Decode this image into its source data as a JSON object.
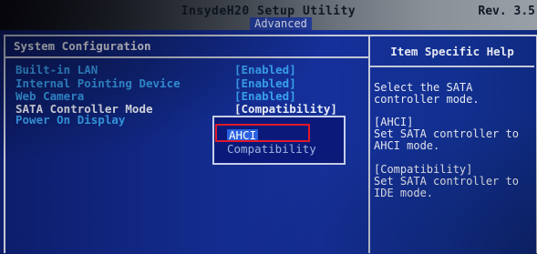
{
  "header": {
    "title": "InsydeH20 Setup Utility",
    "revision": "Rev. 3.5",
    "active_tab": "Advanced"
  },
  "left_panel": {
    "section_title": "System Configuration",
    "items": [
      {
        "label": "Built-in LAN",
        "value": "[Enabled]"
      },
      {
        "label": "Internal Pointing Device",
        "value": "[Enabled]"
      },
      {
        "label": "Web Camera",
        "value": "[Enabled]"
      },
      {
        "label": "SATA Controller Mode",
        "value": "[Compatibility]"
      },
      {
        "label": "Power On Display",
        "value": ""
      }
    ]
  },
  "popup": {
    "options": [
      "AHCI",
      "Compatibility"
    ],
    "selected": "AHCI"
  },
  "right_panel": {
    "title": "Item Specific Help",
    "help_1": "Select the SATA\ncontroller mode.",
    "help_2": "[AHCI]\nSet SATA controller to\nAHCI mode.",
    "help_3": "[Compatibility]\nSet SATA controller to\nIDE mode."
  },
  "colors": {
    "background": "#15309a",
    "item_text": "#3aa2f2",
    "highlight_box": "#e0182a",
    "popup_selected": "#2a62e0"
  }
}
